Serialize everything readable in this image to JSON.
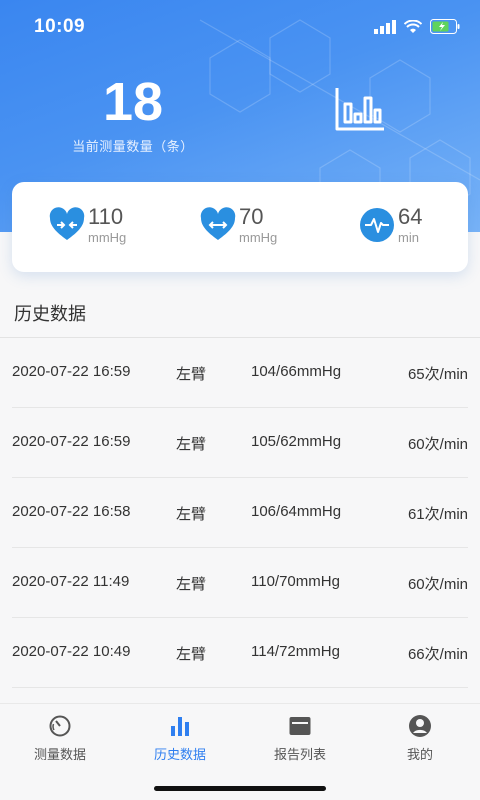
{
  "status_bar": {
    "time": "10:09"
  },
  "summary": {
    "count": "18",
    "count_label": "当前测量数量（条）"
  },
  "metrics": [
    {
      "icon": "heart-compress-icon",
      "value": "110",
      "unit": "mmHg"
    },
    {
      "icon": "heart-expand-icon",
      "value": "70",
      "unit": "mmHg"
    },
    {
      "icon": "pulse-icon",
      "value": "64",
      "unit": "min"
    }
  ],
  "history": {
    "title": "历史数据",
    "rows": [
      {
        "datetime": "2020-07-22 16:59",
        "arm": "左臂",
        "bp": "104/66mmHg",
        "hr": "65次/min"
      },
      {
        "datetime": "2020-07-22 16:59",
        "arm": "左臂",
        "bp": "105/62mmHg",
        "hr": "60次/min"
      },
      {
        "datetime": "2020-07-22 16:58",
        "arm": "左臂",
        "bp": "106/64mmHg",
        "hr": "61次/min"
      },
      {
        "datetime": "2020-07-22 11:49",
        "arm": "左臂",
        "bp": "110/70mmHg",
        "hr": "60次/min"
      },
      {
        "datetime": "2020-07-22 10:49",
        "arm": "左臂",
        "bp": "114/72mmHg",
        "hr": "66次/min"
      }
    ]
  },
  "tabs": [
    {
      "label": "测量数据",
      "icon": "gauge-icon",
      "active": false
    },
    {
      "label": "历史数据",
      "icon": "bar-chart-icon",
      "active": true
    },
    {
      "label": "报告列表",
      "icon": "report-icon",
      "active": false
    },
    {
      "label": "我的",
      "icon": "user-icon",
      "active": false
    }
  ],
  "colors": {
    "accent": "#2f7ff0",
    "hero_start": "#3a86f0",
    "hero_end": "#78b3f7",
    "icon_blue": "#2a8fe0"
  }
}
